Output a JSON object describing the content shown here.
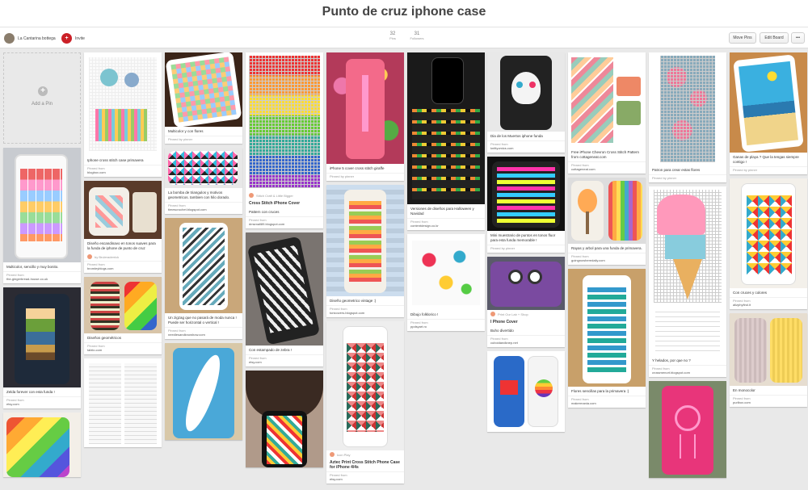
{
  "board": {
    "title": "Punto de cruz iphone case",
    "owner_name": "La Cantarina bottega",
    "invite_label": "Invite",
    "pins_count": "32",
    "pins_label": "Pins",
    "followers_count": "31",
    "followers_label": "Followers",
    "move_pins_label": "Move Pins",
    "edit_board_label": "Edit Board",
    "more_label": "•••"
  },
  "add_pin_label": "Add a Pin",
  "pins": {
    "c1p1_desc": "Multicolor, sencillo y muy bonito.",
    "c1p1_src_label": "Pinned from",
    "c1p1_src": "the-gingerbread-house.co.uk",
    "c1p2_desc": "Zelda forever con esta funda !",
    "c1p2_src_label": "Pinned from",
    "c1p2_src": "etsy.com",
    "c2p1_desc": "Iphone cross stitch case primavera",
    "c2p1_src_label": "Pinned from",
    "c2p1_src": "blogbox.com",
    "c2p2_desc": "Diseño escandinavo en tonos suaves para la funda de iphone de punto de cruz",
    "c2p2_via": "by Bruleraderrick",
    "c2p2_src_label": "Pinned from",
    "c2p2_src": "bromleyblogs.com",
    "c2p3_desc": "Diseños geométricos",
    "c2p3_src_label": "Pinned from",
    "c2p3_src": "tablio.com",
    "c3p1_desc": "Multicolor y con flores",
    "c3p1_src_label": "Pinned by pinner",
    "c3p2_desc": "La bomba de triangulos y motivos geometricos. tambien con hilo dorado.",
    "c3p2_src_label": "Pinned from",
    "c3p2_src": "timescrochet.blogspot.com",
    "c3p3_desc": "Un zigzag que no pasará de moda nunca ! Puede ser horizontal o vertical !",
    "c3p3_src_label": "Pinned from",
    "c3p3_src": "needlesandknowhow.com",
    "c4p1_via": "Stitch Craft & Little Bigger",
    "c4p1_title": "Cross Stitch iPhone Cover",
    "c4p1_desc": "Pattern con cruces",
    "c4p1_src_label": "Pinned from",
    "c4p1_src": "dmsmall89.blogspot.com",
    "c4p2_desc": "Con estampado de zebra !",
    "c4p2_src_label": "Pinned from",
    "c4p2_src": "etsy.com",
    "c5p1_desc": "iPhone 5 cover cross stitch giraffe",
    "c5p1_src_label": "Pinned by pinner",
    "c5p2_desc": "Diseño geometrico vintage :)",
    "c5p2_src_label": "Pinned from",
    "c5p2_src": "tonicovers.blogspot.com",
    "c5p3_via": "Icon Play",
    "c5p3_title": "Aztec Print Cross Stitch Phone Case for iPhone 4/4s",
    "c5p3_src_label": "Pinned from",
    "c5p3_src": "etsy.com",
    "c6p1_desc": "Versiones de diseños para Halloween y Navidad",
    "c6p1_src_label": "Pinned from",
    "c6p1_src": "contentdesign.co.kr",
    "c6p2_desc": "Dibujo folklorico !",
    "c6p2_src_label": "Pinned from",
    "c6p2_src": "ppdsyart.ro",
    "c7p1_desc": "Dia de los Muertos iphone funda",
    "c7p1_src_label": "Pinned from",
    "c7p1_src": "knittyomics.com",
    "c7p2_desc": "Mini muestrario de puntos en tonos fluor para esta funda memorable !",
    "c7p2_src_label": "Pinned by pinner",
    "c7p3_via": "Print Our Lab + Shop",
    "c7p3_title": "I Phone Cover",
    "c7p3_desc": "Buho divertido",
    "c7p3_src_label": "Pinned from",
    "c7p3_src": "cuboidandknep.net",
    "c8p1_desc": "Free iPhone Chevron Cross Stitch Pattern from cottageneat.com",
    "c8p1_src_label": "Pinned from",
    "c8p1_src": "cottageneat.com",
    "c8p2_desc": "Rayas y arbol para una funda de primavera.",
    "c8p2_src_label": "Pinned from",
    "c8p2_src": "goingnowheredaily.com",
    "c8p3_desc": "Flores sencillas para la primavera :)",
    "c8p3_src_label": "Pinned from",
    "c8p3_src": "makermania.com",
    "c9p1_desc": "Patron para crear estas flores",
    "c9p1_src_label": "Pinned by pinner",
    "c9p2_desc": "Y helados, por que no ?",
    "c9p2_src_label": "Pinned from",
    "c9p2_src": "crossmenort.blogspot.com",
    "c10p1_desc": "Ganas de playa ? Que la tengas siempre contigo !",
    "c10p1_src_label": "Pinned by pinner",
    "c10p2_desc": "Con cruces y colores",
    "c10p2_src_label": "Pinned from",
    "c10p2_src": "alizphyfind.it",
    "c10p3_desc": "En monocolor",
    "c10p3_src_label": "Pinned from",
    "c10p3_src": "purlbox.com"
  },
  "colors": {
    "background": "#e9e9e9",
    "accent": "#cb2027",
    "card": "#ffffff"
  }
}
